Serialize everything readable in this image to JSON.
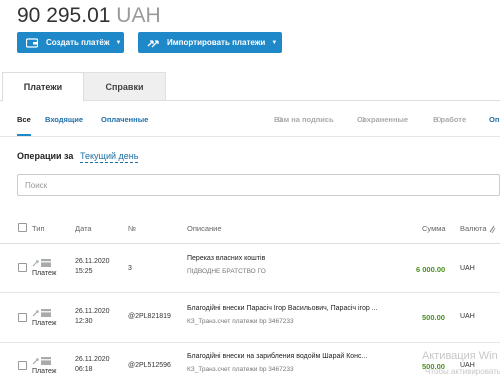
{
  "balance": {
    "amount": "90 295.01",
    "currency": "UAH"
  },
  "actions": {
    "create_label": "Создать платёж",
    "import_label": "Импортировать платежи"
  },
  "tabs": [
    {
      "label": "Платежи",
      "active": true
    },
    {
      "label": "Справки",
      "active": false
    }
  ],
  "subtabs": {
    "all": "Все",
    "incoming": "Входящие",
    "paid": "Оплаченные",
    "to_sign": {
      "label": "Вам на подпись",
      "count": "0"
    },
    "saved": {
      "label": "Сохраненные",
      "count": "0"
    },
    "in_work": {
      "label": "В работе",
      "count": "0"
    },
    "more": "Оп"
  },
  "operations": {
    "label": "Операции за",
    "period": "Текущий день"
  },
  "search": {
    "placeholder": "Поиск"
  },
  "table": {
    "headers": {
      "type": "Тип",
      "date": "Дата",
      "number": "№",
      "description": "Описание",
      "amount": "Сумма",
      "currency": "Валюта"
    },
    "rows": [
      {
        "type": "Платеж",
        "date": "26.11.2020",
        "time": "15:25",
        "number": "3",
        "desc1": "Переказ власних коштів",
        "desc2": "ПІДВОДНЕ БРАТСТВО ГО",
        "amount": "6 000.00",
        "currency": "UAH"
      },
      {
        "type": "Платеж",
        "date": "26.11.2020",
        "time": "12:30",
        "number": "@2PL821819",
        "desc1": "Благодійні внески Парасіч Ігор Васильович, Парасіч ігор ...",
        "desc2": "КЗ_Транз.счет платежи bp 3467233",
        "amount": "500.00",
        "currency": "UAH"
      },
      {
        "type": "Платеж",
        "date": "26.11.2020",
        "time": "06:18",
        "number": "@2PL512596",
        "desc1": "Благодійні внески на зарибления водойм Шарай Конс...",
        "desc2": "КЗ_Транз.счет платежи bp 3467233",
        "amount": "500.00",
        "currency": "UAH"
      }
    ]
  },
  "watermark": {
    "line1": "Активация Win",
    "line2": "Чтобы активировать"
  },
  "colors": {
    "accent": "#1e88c9",
    "link": "#1e6fa8",
    "amount": "#4a8f1f"
  },
  "icons": {
    "create": "wallet-icon",
    "import": "import-arrow-icon",
    "type": "payment-type-icon"
  }
}
